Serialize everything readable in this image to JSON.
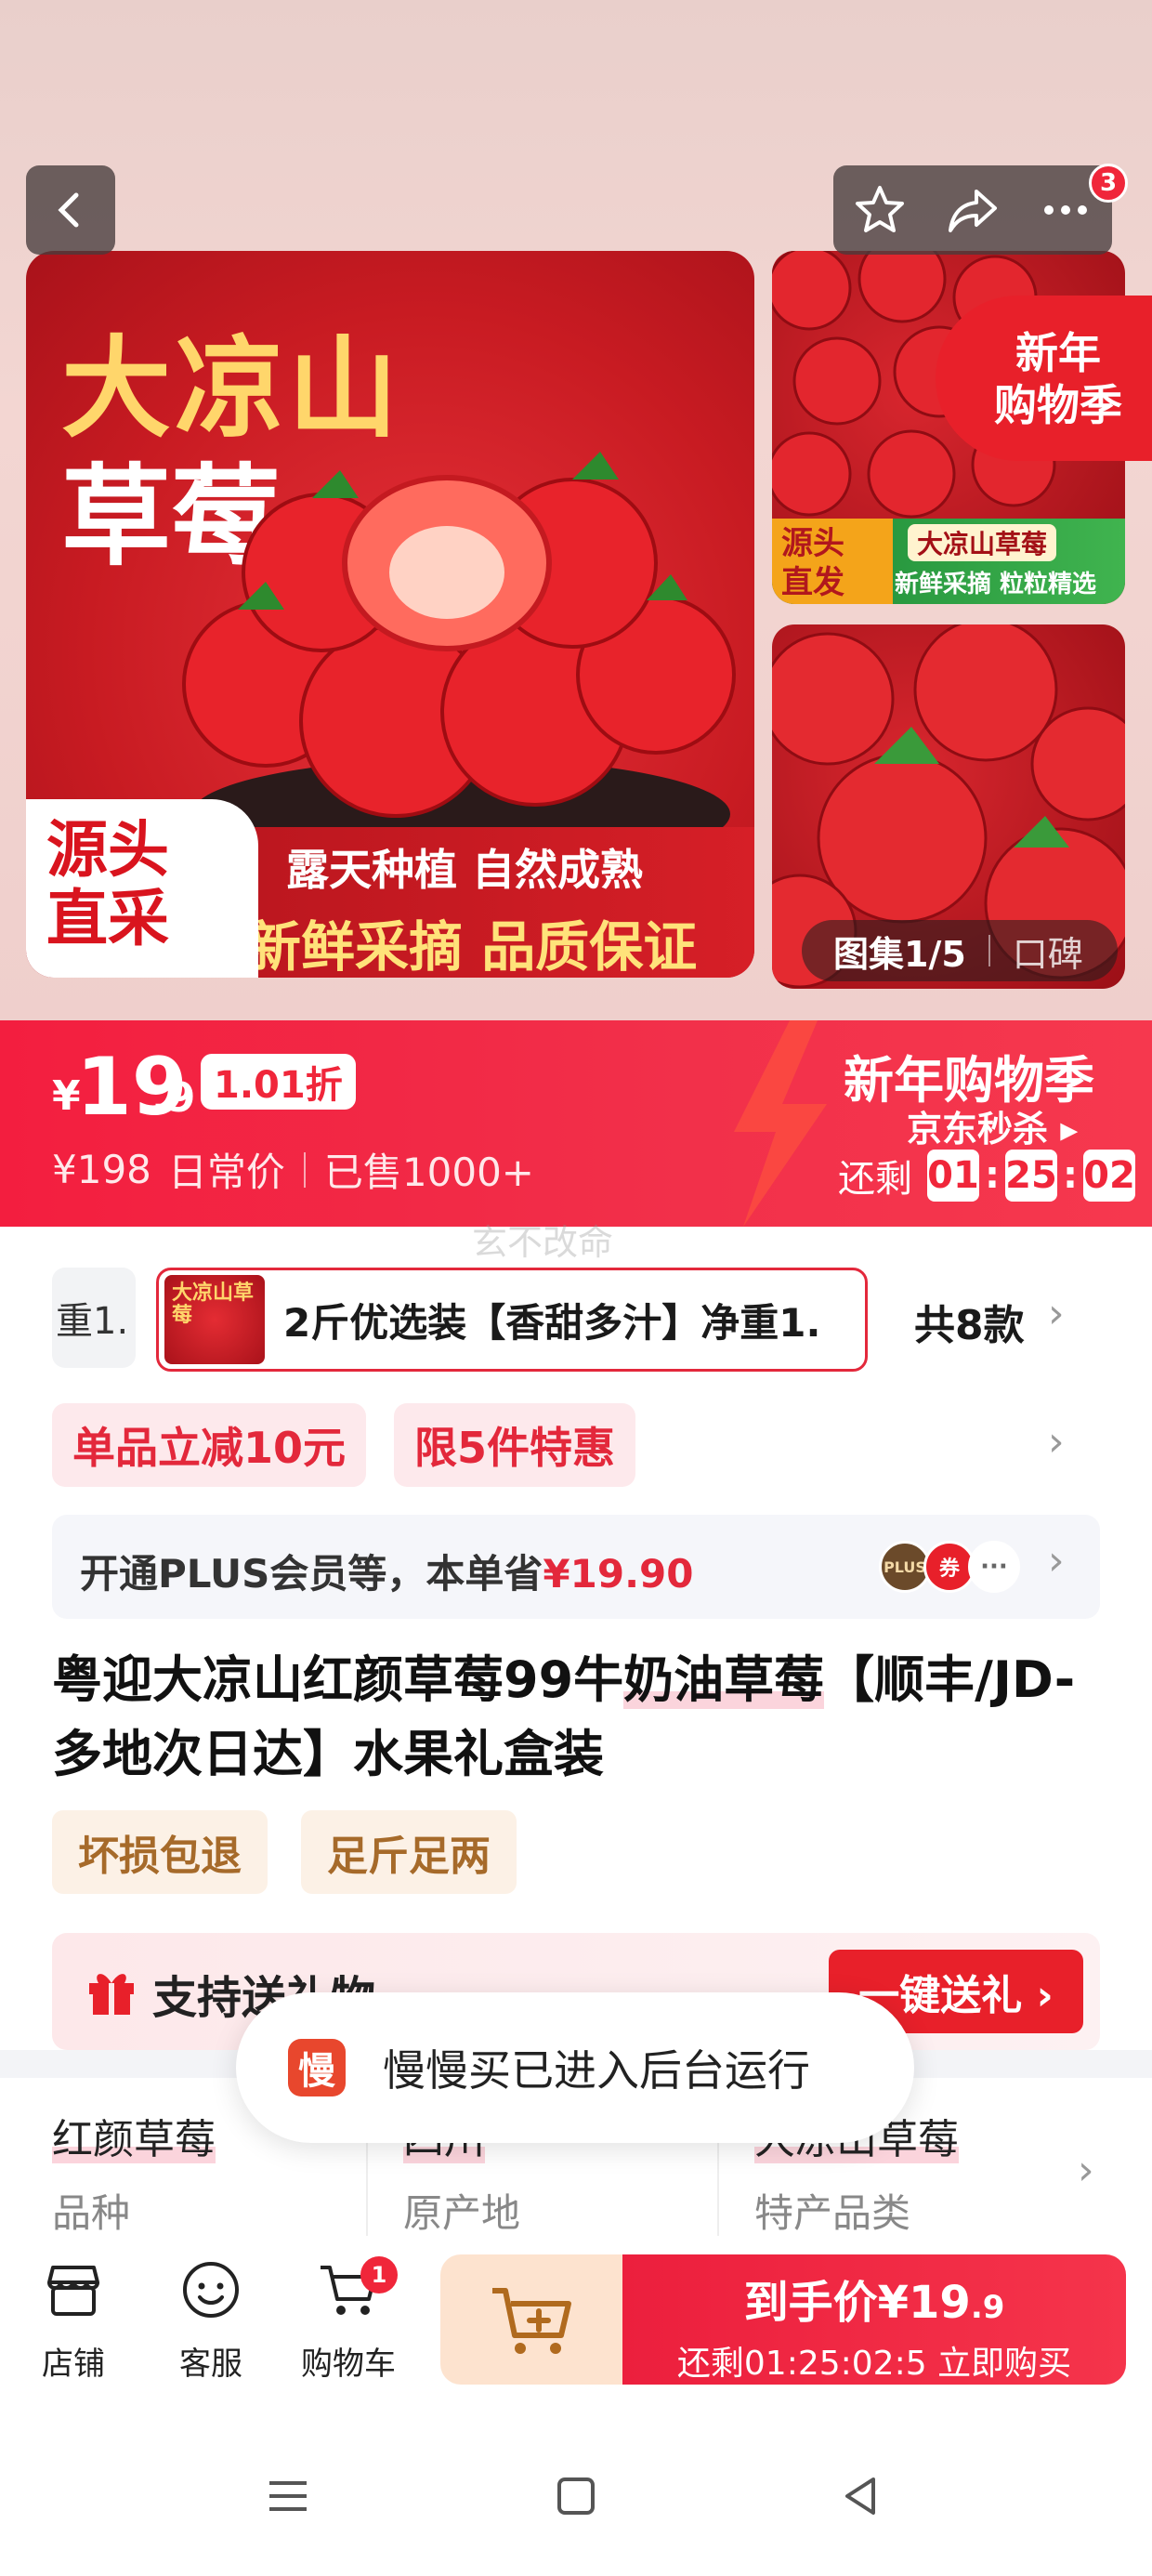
{
  "nav": {
    "cart_badge": "3"
  },
  "hero": {
    "title_line1": "大凉山",
    "title_line2": "草莓",
    "corner_label": "源头\n直采",
    "band_line1": "露天种植 自然成熟",
    "band_line2": "新鲜采摘 品质保证",
    "side_tag": "新年\n购物季",
    "side_strip_a": "源头\n直发",
    "side_strip_b": "大凉山草莓",
    "side_strip_c": "新鲜采摘 粒粒精选",
    "gallery_label": "图集1/5",
    "reviews_label": "口碑"
  },
  "price": {
    "currency": "¥",
    "integer": "19",
    "decimal": ".9",
    "discount": "1.01折",
    "original": "¥198",
    "original_label": "日常价",
    "sold": "已售1000+",
    "promo_title": "新年购物季",
    "promo_sub": "京东秒杀 ▸",
    "countdown_label": "还剩",
    "hh": "01",
    "mm": "25",
    "ss": "02"
  },
  "watermark": "玄不改命",
  "variants": {
    "prev_text": "重1.",
    "thumb_text": "大凉山草莓",
    "selected": "2斤优选装【香甜多汁】净重1.",
    "count": "共8款"
  },
  "promos": [
    "单品立减10元",
    "限5件特惠"
  ],
  "plus": {
    "text": "开通PLUS会员等，本单省",
    "amount": "¥19.90",
    "icon1": "PLUS",
    "icon2": "券",
    "icon3": "···"
  },
  "title": {
    "part1": "粤迎大凉山红颜草莓99牛",
    "highlight": "奶油草莓",
    "part2": "【顺丰/JD-多地次日达】水果礼盒装"
  },
  "services": [
    "坏损包退",
    "足斤足两"
  ],
  "gift": {
    "label": "支持送礼物",
    "button": "一键送礼 ›"
  },
  "specs": [
    {
      "value": "红颜草莓",
      "key": "品种"
    },
    {
      "value": "四川",
      "key": "原产地"
    },
    {
      "value": "大凉山草莓",
      "key": "特产品类"
    }
  ],
  "toast": {
    "icon": "慢",
    "text": "慢慢买已进入后台运行"
  },
  "bottom": {
    "store": "店铺",
    "service": "客服",
    "cart": "购物车",
    "cart_badge": "1",
    "buy_line1": "到手价¥19",
    "buy_decimal": ".9",
    "buy_line2": "还剩01:25:02:5 立即购买"
  },
  "colors": {
    "accent": "#f0263a",
    "tag_bg": "#fde9ec",
    "service_text": "#a66a2a"
  }
}
